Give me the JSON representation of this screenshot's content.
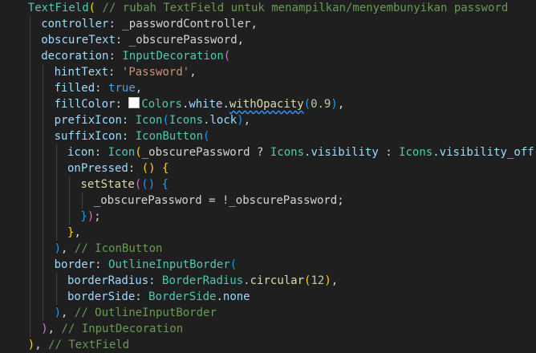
{
  "editor": {
    "theme": {
      "background": "#1f1f1f",
      "color_swatch": "#ffffff"
    },
    "lines": [
      {
        "indent": 4,
        "tokens": [
          {
            "c": "t-cls",
            "t": "TextField"
          },
          {
            "c": "t-p1",
            "t": "("
          },
          {
            "c": "t-cmt",
            "t": " // rubah TextField untuk menampilkan/menyembunyikan password"
          }
        ]
      },
      {
        "indent": 6,
        "tokens": [
          {
            "c": "t-prop",
            "t": "controller"
          },
          {
            "c": "t-pun",
            "t": ": _passwordController,"
          }
        ]
      },
      {
        "indent": 6,
        "tokens": [
          {
            "c": "t-prop",
            "t": "obscureText"
          },
          {
            "c": "t-pun",
            "t": ": _obscurePassword,"
          }
        ]
      },
      {
        "indent": 6,
        "tokens": [
          {
            "c": "t-prop",
            "t": "decoration"
          },
          {
            "c": "t-pun",
            "t": ": "
          },
          {
            "c": "t-cls",
            "t": "InputDecoration"
          },
          {
            "c": "t-p2",
            "t": "("
          }
        ]
      },
      {
        "indent": 8,
        "tokens": [
          {
            "c": "t-prop",
            "t": "hintText"
          },
          {
            "c": "t-pun",
            "t": ": "
          },
          {
            "c": "t-str",
            "t": "'Password'"
          },
          {
            "c": "t-pun",
            "t": ","
          }
        ]
      },
      {
        "indent": 8,
        "tokens": [
          {
            "c": "t-prop",
            "t": "filled"
          },
          {
            "c": "t-pun",
            "t": ": "
          },
          {
            "c": "t-kw",
            "t": "true"
          },
          {
            "c": "t-pun",
            "t": ","
          }
        ]
      },
      {
        "indent": 8,
        "tokens": [
          {
            "c": "t-prop",
            "t": "fillColor"
          },
          {
            "c": "t-pun",
            "t": ": "
          },
          {
            "c": "swatch",
            "t": ""
          },
          {
            "c": "t-cls",
            "t": "Colors"
          },
          {
            "c": "t-pun",
            "t": "."
          },
          {
            "c": "t-prop",
            "t": "white"
          },
          {
            "c": "t-pun",
            "t": "."
          },
          {
            "c": "t-dep squig",
            "t": "withOpacity"
          },
          {
            "c": "t-p3",
            "t": "("
          },
          {
            "c": "t-num",
            "t": "0.9"
          },
          {
            "c": "t-p3",
            "t": ")"
          },
          {
            "c": "t-pun",
            "t": ","
          }
        ]
      },
      {
        "indent": 8,
        "tokens": [
          {
            "c": "t-prop",
            "t": "prefixIcon"
          },
          {
            "c": "t-pun",
            "t": ": "
          },
          {
            "c": "t-cls",
            "t": "Icon"
          },
          {
            "c": "t-p3",
            "t": "("
          },
          {
            "c": "t-cls",
            "t": "Icons"
          },
          {
            "c": "t-pun",
            "t": "."
          },
          {
            "c": "t-prop",
            "t": "lock"
          },
          {
            "c": "t-p3",
            "t": ")"
          },
          {
            "c": "t-pun",
            "t": ","
          }
        ]
      },
      {
        "indent": 8,
        "tokens": [
          {
            "c": "t-prop",
            "t": "suffixIcon"
          },
          {
            "c": "t-pun",
            "t": ": "
          },
          {
            "c": "t-cls",
            "t": "IconButton"
          },
          {
            "c": "t-p3",
            "t": "("
          }
        ]
      },
      {
        "indent": 10,
        "tokens": [
          {
            "c": "t-prop",
            "t": "icon"
          },
          {
            "c": "t-pun",
            "t": ": "
          },
          {
            "c": "t-cls",
            "t": "Icon"
          },
          {
            "c": "t-p1",
            "t": "("
          },
          {
            "c": "t-pun",
            "t": "_obscurePassword ? "
          },
          {
            "c": "t-cls",
            "t": "Icons"
          },
          {
            "c": "t-pun",
            "t": "."
          },
          {
            "c": "t-prop",
            "t": "visibility"
          },
          {
            "c": "t-pun",
            "t": " : "
          },
          {
            "c": "t-cls",
            "t": "Icons"
          },
          {
            "c": "t-pun",
            "t": "."
          },
          {
            "c": "t-prop",
            "t": "visibility_off"
          },
          {
            "c": "t-p1",
            "t": ")"
          },
          {
            "c": "t-pun",
            "t": ","
          }
        ]
      },
      {
        "indent": 10,
        "tokens": [
          {
            "c": "t-prop",
            "t": "onPressed"
          },
          {
            "c": "t-pun",
            "t": ": "
          },
          {
            "c": "t-p1",
            "t": "()"
          },
          {
            "c": "t-pun",
            "t": " "
          },
          {
            "c": "t-p1",
            "t": "{"
          }
        ]
      },
      {
        "indent": 12,
        "tokens": [
          {
            "c": "t-fn",
            "t": "setState"
          },
          {
            "c": "t-p2",
            "t": "("
          },
          {
            "c": "t-p3",
            "t": "()"
          },
          {
            "c": "t-pun",
            "t": " "
          },
          {
            "c": "t-p3",
            "t": "{"
          }
        ]
      },
      {
        "indent": 14,
        "tokens": [
          {
            "c": "t-pun",
            "t": "_obscurePassword = !_obscurePassword;"
          }
        ]
      },
      {
        "indent": 12,
        "tokens": [
          {
            "c": "t-p3",
            "t": "}"
          },
          {
            "c": "t-p2",
            "t": ")"
          },
          {
            "c": "t-pun",
            "t": ";"
          }
        ]
      },
      {
        "indent": 10,
        "tokens": [
          {
            "c": "t-p1",
            "t": "}"
          },
          {
            "c": "t-pun",
            "t": ","
          }
        ]
      },
      {
        "indent": 8,
        "tokens": [
          {
            "c": "t-p3",
            "t": ")"
          },
          {
            "c": "t-pun",
            "t": ", "
          },
          {
            "c": "t-cmt",
            "t": "// IconButton"
          }
        ]
      },
      {
        "indent": 8,
        "tokens": [
          {
            "c": "t-prop",
            "t": "border"
          },
          {
            "c": "t-pun",
            "t": ": "
          },
          {
            "c": "t-cls",
            "t": "OutlineInputBorder"
          },
          {
            "c": "t-p3",
            "t": "("
          }
        ]
      },
      {
        "indent": 10,
        "tokens": [
          {
            "c": "t-prop",
            "t": "borderRadius"
          },
          {
            "c": "t-pun",
            "t": ": "
          },
          {
            "c": "t-cls",
            "t": "BorderRadius"
          },
          {
            "c": "t-pun",
            "t": "."
          },
          {
            "c": "t-fn",
            "t": "circular"
          },
          {
            "c": "t-p1",
            "t": "("
          },
          {
            "c": "t-num",
            "t": "12"
          },
          {
            "c": "t-p1",
            "t": ")"
          },
          {
            "c": "t-pun",
            "t": ","
          }
        ]
      },
      {
        "indent": 10,
        "tokens": [
          {
            "c": "t-prop",
            "t": "borderSide"
          },
          {
            "c": "t-pun",
            "t": ": "
          },
          {
            "c": "t-cls",
            "t": "BorderSide"
          },
          {
            "c": "t-pun",
            "t": "."
          },
          {
            "c": "t-prop",
            "t": "none"
          }
        ]
      },
      {
        "indent": 8,
        "tokens": [
          {
            "c": "t-p3",
            "t": ")"
          },
          {
            "c": "t-pun",
            "t": ", "
          },
          {
            "c": "t-cmt",
            "t": "// OutlineInputBorder"
          }
        ]
      },
      {
        "indent": 6,
        "tokens": [
          {
            "c": "t-p2",
            "t": ")"
          },
          {
            "c": "t-pun",
            "t": ", "
          },
          {
            "c": "t-cmt",
            "t": "// InputDecoration"
          }
        ]
      },
      {
        "indent": 4,
        "tokens": [
          {
            "c": "t-p1",
            "t": ")"
          },
          {
            "c": "t-pun",
            "t": ", "
          },
          {
            "c": "t-cmt",
            "t": "// TextField"
          }
        ]
      }
    ]
  }
}
